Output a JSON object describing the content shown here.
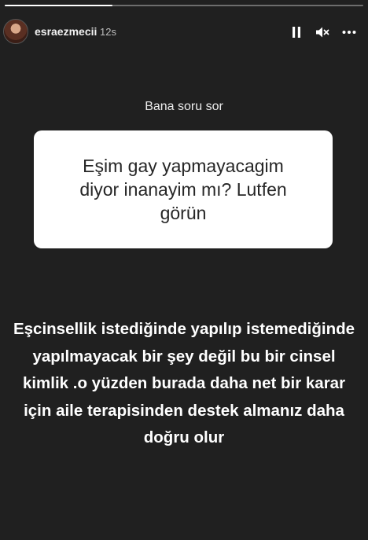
{
  "header": {
    "username": "esraezmecii",
    "timestamp": "12s",
    "progress_fraction": 0.3
  },
  "icons": {
    "avatar": "profile-avatar",
    "pause": "pause-icon",
    "mute": "speaker-muted-icon",
    "more": "more-horizontal-icon"
  },
  "question": {
    "label": "Bana soru sor",
    "text": "Eşim gay yapmayacagim diyor inanayim mı? Lutfen görün"
  },
  "answer": {
    "text": "Eşcinsellik istediğinde yapılıp istemediğinde yapılmayacak bir şey değil bu bir cinsel kimlik .o yüzden burada daha net bir karar için aile terapisinden destek almanız daha doğru olur"
  },
  "colors": {
    "background": "#202020",
    "card": "#ffffff",
    "card_text": "#262626",
    "text": "#ffffff"
  }
}
